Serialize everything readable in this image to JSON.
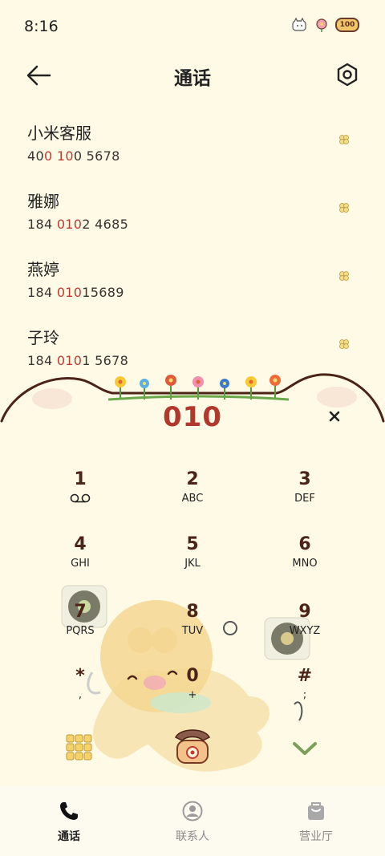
{
  "status": {
    "time": "8:16",
    "battery": "100"
  },
  "header": {
    "title": "通话"
  },
  "contacts": [
    {
      "name": "小米客服",
      "num_pre": "40",
      "num_hl1": "0",
      "num_mid": " ",
      "num_hl2": "10",
      "num_post": "0 5678"
    },
    {
      "name": "雅娜",
      "num_pre": "184 ",
      "num_hl1": "010",
      "num_mid": "",
      "num_hl2": "",
      "num_post": "2 4685"
    },
    {
      "name": "燕婷",
      "num_pre": "184 ",
      "num_hl1": "010",
      "num_mid": "",
      "num_hl2": "",
      "num_post": "15689"
    },
    {
      "name": "子玲",
      "num_pre": "184 ",
      "num_hl1": "010",
      "num_mid": "",
      "num_hl2": "",
      "num_post": "1 5678"
    }
  ],
  "dialer": {
    "input": "010"
  },
  "keypad": [
    {
      "digit": "1",
      "sub": ""
    },
    {
      "digit": "2",
      "sub": "ABC"
    },
    {
      "digit": "3",
      "sub": "DEF"
    },
    {
      "digit": "4",
      "sub": "GHI"
    },
    {
      "digit": "5",
      "sub": "JKL"
    },
    {
      "digit": "6",
      "sub": "MNO"
    },
    {
      "digit": "7",
      "sub": "PQRS"
    },
    {
      "digit": "8",
      "sub": "TUV"
    },
    {
      "digit": "9",
      "sub": "WXYZ"
    },
    {
      "digit": "*",
      "sub": ","
    },
    {
      "digit": "0",
      "sub": "+"
    },
    {
      "digit": "#",
      "sub": ";"
    }
  ],
  "nav": [
    {
      "label": "通话",
      "icon": "phone-icon"
    },
    {
      "label": "联系人",
      "icon": "person-icon"
    },
    {
      "label": "营业厅",
      "icon": "shopping-bag-icon"
    }
  ],
  "colors": {
    "background": "#FEFAE6",
    "accent": "#B0392E",
    "keypad_digit": "#4B2417"
  }
}
